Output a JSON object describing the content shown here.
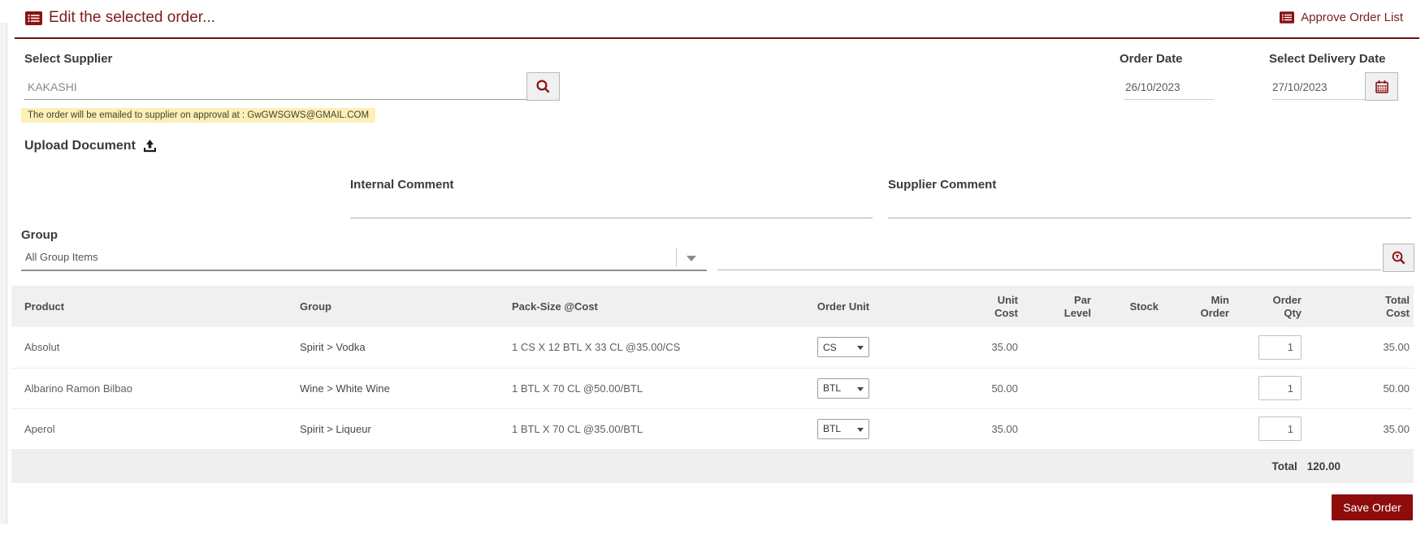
{
  "header": {
    "title": "Edit the selected order...",
    "approve_label": "Approve Order List"
  },
  "supplier": {
    "label": "Select Supplier",
    "value": "KAKASHI",
    "note": "The order will be emailed to supplier on approval at : GwGWSGWS@GMAIL.COM"
  },
  "dates": {
    "order_date_label": "Order Date",
    "order_date_value": "26/10/2023",
    "delivery_label": "Select Delivery Date",
    "delivery_value": "27/10/2023"
  },
  "upload": {
    "label": "Upload Document"
  },
  "comments": {
    "internal_label": "Internal Comment",
    "supplier_label": "Supplier Comment",
    "internal_value": "",
    "supplier_value": ""
  },
  "group": {
    "label": "Group",
    "selected": "All Group Items"
  },
  "table": {
    "columns": [
      "Product",
      "Group",
      "Pack-Size @Cost",
      "Order Unit",
      "Unit Cost",
      "Par Level",
      "Stock",
      "Min Order",
      "Order Qty",
      "Total Cost"
    ],
    "rows": [
      {
        "product": "Absolut",
        "group": "Spirit > Vodka",
        "pack": "1 CS X 12 BTL X 33 CL  @35.00/CS",
        "order_unit": "CS",
        "unit_cost": "35.00",
        "par_level": "",
        "stock": "",
        "min_order": "",
        "qty": "1",
        "total": "35.00"
      },
      {
        "product": "Albarino Ramon Bilbao",
        "group": "Wine > White Wine",
        "pack": "1 BTL X 70 CL  @50.00/BTL",
        "order_unit": "BTL",
        "unit_cost": "50.00",
        "par_level": "",
        "stock": "",
        "min_order": "",
        "qty": "1",
        "total": "50.00"
      },
      {
        "product": "Aperol",
        "group": "Spirit > Liqueur",
        "pack": "1 BTL X 70 CL  @35.00/BTL",
        "order_unit": "BTL",
        "unit_cost": "35.00",
        "par_level": "",
        "stock": "",
        "min_order": "",
        "qty": "1",
        "total": "35.00"
      }
    ],
    "footer": {
      "total_label": "Total",
      "total_value": "120.00"
    }
  },
  "actions": {
    "save_label": "Save Order"
  },
  "colors": {
    "accent_text": "#7e1c1c",
    "icon_red": "#8b1111",
    "button_red": "#8e0c0c",
    "note_bg": "#fdf0b6",
    "header_line": "#6f1010"
  }
}
